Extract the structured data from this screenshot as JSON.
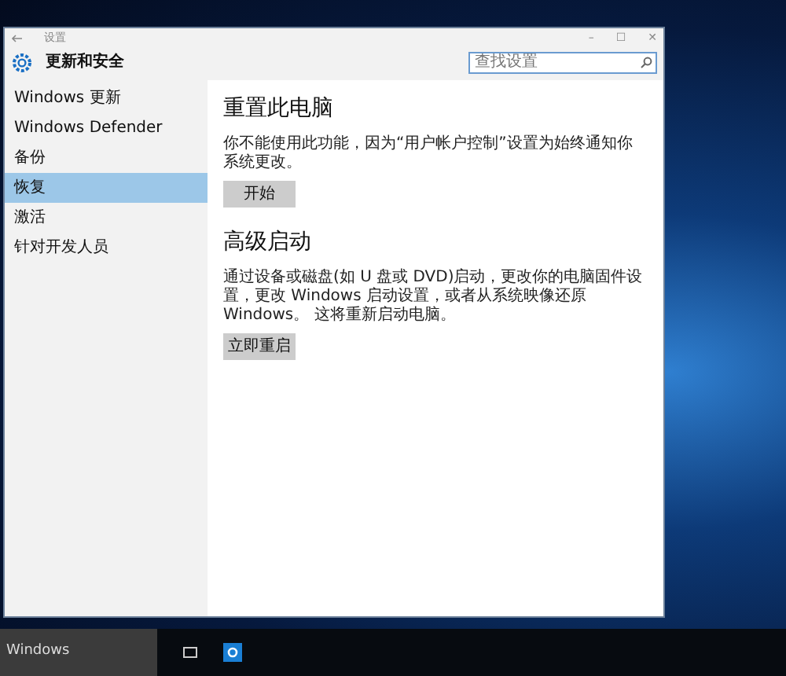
{
  "window": {
    "title": "设置",
    "controls": [
      "–",
      "☐",
      "✕"
    ]
  },
  "header": {
    "title": "更新和安全",
    "search": {
      "placeholder": "查找设置"
    }
  },
  "sidebar": {
    "items": [
      {
        "label": "Windows 更新",
        "selected": false
      },
      {
        "label": "Windows Defender",
        "selected": false
      },
      {
        "label": "备份",
        "selected": false
      },
      {
        "label": "恢复",
        "selected": true
      },
      {
        "label": "激活",
        "selected": false
      },
      {
        "label": "针对开发人员",
        "selected": false
      }
    ]
  },
  "sections": [
    {
      "heading": "重置此电脑",
      "text": "你不能使用此功能，因为“用户帐户控制”设置为始终通知你系统更改。",
      "button": "开始"
    },
    {
      "heading": "高级启动",
      "text": "通过设备或磁盘(如 U 盘或 DVD)启动，更改你的电脑固件设置，更改 Windows 启动设置，或者从系统映像还原 Windows。 这将重新启动电脑。",
      "button": "立即重启"
    }
  ],
  "taskbar": {
    "search_text": "Windows"
  }
}
